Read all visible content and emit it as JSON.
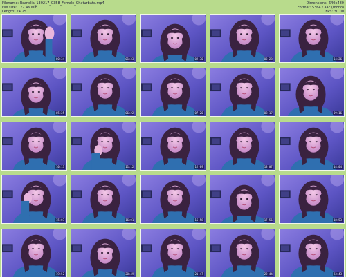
{
  "header": {
    "filename_line": "Filename: Reznolia_130217_0358_Female_Chaturbate.mp4",
    "filesize_line": "File size: 172.46 MiB",
    "length_line": "Length: 24:25",
    "dimensions_line": "Dimensions: 640x480",
    "format_line": "Format: 5364 / aac (mono)",
    "fps_line": "FPS: 30.00"
  },
  "colors": {
    "sheet_background": "#b8db8c",
    "thumb_border": "#f1f6ea"
  },
  "thumbnails": [
    {
      "timestamp": "00:34",
      "scene": "hand-raised"
    },
    {
      "timestamp": "01:33",
      "scene": "portrait"
    },
    {
      "timestamp": "02:30",
      "scene": "portrait-low"
    },
    {
      "timestamp": "03:28",
      "scene": "portrait"
    },
    {
      "timestamp": "04:26",
      "scene": "portrait"
    },
    {
      "timestamp": "05:25",
      "scene": "portrait-low"
    },
    {
      "timestamp": "06:22",
      "scene": "portrait"
    },
    {
      "timestamp": "07:20",
      "scene": "portrait"
    },
    {
      "timestamp": "08:17",
      "scene": "portrait"
    },
    {
      "timestamp": "09:16",
      "scene": "leaning"
    },
    {
      "timestamp": "10:13",
      "scene": "portrait"
    },
    {
      "timestamp": "11:12",
      "scene": "hand-chin"
    },
    {
      "timestamp": "12:09",
      "scene": "portrait"
    },
    {
      "timestamp": "13:07",
      "scene": "portrait"
    },
    {
      "timestamp": "14:04",
      "scene": "portrait"
    },
    {
      "timestamp": "15:03",
      "scene": "hand-cheek"
    },
    {
      "timestamp": "16:01",
      "scene": "portrait"
    },
    {
      "timestamp": "16:58",
      "scene": "portrait"
    },
    {
      "timestamp": "17:56",
      "scene": "portrait-low"
    },
    {
      "timestamp": "18:53",
      "scene": "portrait"
    },
    {
      "timestamp": "19:52",
      "scene": "portrait"
    },
    {
      "timestamp": "20:49",
      "scene": "portrait-low"
    },
    {
      "timestamp": "21:47",
      "scene": "portrait"
    },
    {
      "timestamp": "22:44",
      "scene": "portrait"
    },
    {
      "timestamp": "23:43",
      "scene": "portrait"
    }
  ]
}
